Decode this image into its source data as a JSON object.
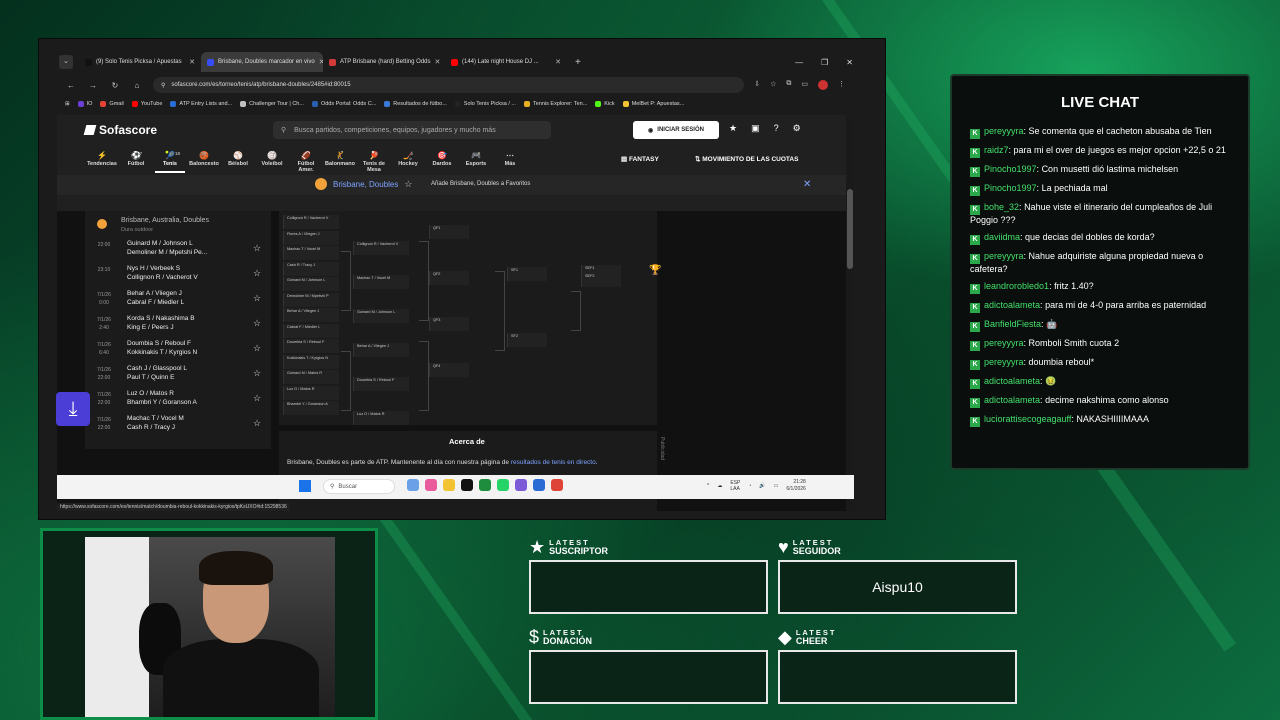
{
  "browser": {
    "tabs": [
      {
        "label": "(9) Solo Tenis Picksa / Apuestas",
        "active": false,
        "color": "#111111"
      },
      {
        "label": "Brisbane, Doubles marcador en vivo",
        "active": true,
        "color": "#374df5"
      },
      {
        "label": "ATP Brisbane (hard) Betting Odds",
        "active": false,
        "color": "#d33a3a"
      },
      {
        "label": "(144) Late night House DJ ...",
        "active": false,
        "color": "#ff0000"
      }
    ],
    "url": "sofascore.com/es/torneo/tenis/atp/brisbane-doubles/2485#id:80015",
    "bookmarks": [
      {
        "label": "IO",
        "color": "#6b3fd6"
      },
      {
        "label": "Gmail",
        "color": "#e34133"
      },
      {
        "label": "YouTube",
        "color": "#ff0000"
      },
      {
        "label": "ATP Entry Lists and...",
        "color": "#2b6cd4"
      },
      {
        "label": "Challenger Tour | Ch...",
        "color": "#c0c0c0"
      },
      {
        "label": "Odds Portal: Odds C...",
        "color": "#2a5fb0"
      },
      {
        "label": "Resultados de fútbo...",
        "color": "#3a7bd5"
      },
      {
        "label": "Solo Tenis Picksa / ...",
        "color": "#222222"
      },
      {
        "label": "Tennis Explorer: Ten...",
        "color": "#e8b020"
      },
      {
        "label": "Kick",
        "color": "#53fc18"
      },
      {
        "label": "MelBet P: Apuestas...",
        "color": "#f2c230"
      }
    ]
  },
  "sofascore": {
    "logo": "Sofascore",
    "search_placeholder": "Busca partidos, competiciones, equipos, jugadores y mucho más",
    "login_label": "INICIAR SESIÓN",
    "sports": [
      {
        "label": "Tendencias",
        "icon": "⚡",
        "count": ""
      },
      {
        "label": "Fútbol",
        "icon": "⚽",
        "count": "7"
      },
      {
        "label": "Tenis",
        "icon": "🎾",
        "count": "18"
      },
      {
        "label": "Baloncesto",
        "icon": "🏀",
        "count": "20"
      },
      {
        "label": "Béisbol",
        "icon": "⚾",
        "count": ""
      },
      {
        "label": "Voleibol",
        "icon": "🏐",
        "count": "4"
      },
      {
        "label": "Fútbol Amer.",
        "icon": "🏈",
        "count": ""
      },
      {
        "label": "Balonmano",
        "icon": "🤾",
        "count": ""
      },
      {
        "label": "Tenis de Mesa",
        "icon": "🏓",
        "count": "6"
      },
      {
        "label": "Hockey",
        "icon": "🏒",
        "count": "4"
      },
      {
        "label": "Dardos",
        "icon": "🎯",
        "count": ""
      },
      {
        "label": "Esports",
        "icon": "🎮",
        "count": "2"
      },
      {
        "label": "Más",
        "icon": "⋯",
        "count": ""
      }
    ],
    "fantasy": "FANTASY",
    "odds_movement": "MOVIMIENTO DE LAS CUOTAS",
    "banner": {
      "title": "Brisbane, Doubles",
      "add_favorite": "Añade Brisbane, Doubles a Favoritos"
    },
    "left_panel": {
      "title": "Brisbane, Australia, Doubles",
      "subtitle": "Dura outdoor",
      "matches": [
        {
          "date": "",
          "time": "22:00",
          "team1": "Guinard M / Johnson L",
          "team2": "Demoliner M / Mpetshi Pe..."
        },
        {
          "date": "",
          "time": "23:10",
          "team1": "Nys H / Verbeek S",
          "team2": "Collignon R / Vacherot V"
        },
        {
          "date": "7/1/26",
          "time": "0:00",
          "team1": "Behar A / Vliegen J",
          "team2": "Cabral F / Miedler L"
        },
        {
          "date": "7/1/26",
          "time": "2:40",
          "team1": "Korda S / Nakashima B",
          "team2": "King E / Peers J"
        },
        {
          "date": "7/1/26",
          "time": "6:40",
          "team1": "Doumbia S / Reboul F",
          "team2": "Kokkinakis T / Kyrgios N"
        },
        {
          "date": "7/1/26",
          "time": "22:00",
          "team1": "Cash J / Glasspool L",
          "team2": "Paul T / Quinn E"
        },
        {
          "date": "7/1/26",
          "time": "22:00",
          "team1": "Luz O / Matos R",
          "team2": "Bhambri Y / Goranson A"
        },
        {
          "date": "7/1/26",
          "time": "22:00",
          "team1": "Machac T / Vocel M",
          "team2": "Cash R / Tracy J"
        }
      ]
    },
    "bracket": {
      "r1": [
        "Collignon R / Vacherot V",
        "Flores A / Vliegen J",
        "Machac T / Vocel M",
        "Cash R / Tracy J",
        "Guinard M / Johnson L",
        "Demoliner M / Mpetshi P",
        "Behar A / Vliegen J",
        "Cabral F / Miedler L",
        "Doumbia S / Reboul F",
        "Kokkinakis T / Kyrgios N",
        "Guinard M / Matos R",
        "Luz O / Matos R",
        "Bhambri Y / Goranson A"
      ],
      "r2": [
        "Collignon R / Vacherot V",
        "Machac T / Vocel M",
        "Guinard M / Johnson L",
        "Behar A / Vliegen J",
        "Doumbia S / Reboul F",
        "Luz O / Matos R"
      ],
      "qf": [
        "QF1",
        "QF2",
        "QF3",
        "QF4"
      ],
      "sf": [
        "SF1",
        "SF2"
      ],
      "f": [
        "SEF1",
        "SEF2"
      ]
    },
    "about": {
      "title": "Acerca de",
      "text_before": "Brisbane, Doubles es parte de ATP. Mantenente al día con nuestra página de ",
      "link": "resultados de tenis en directo",
      "text_after": "."
    },
    "publicidad": "Publicidad",
    "status_url": "https://www.sofascore.com/es/tennis/match/doumbia-reboul-kokkinakis-kyrgios/tpKsUXO#id:15298536"
  },
  "taskbar": {
    "search": "Buscar",
    "lang": "ESP\nLAA",
    "time": "21:28",
    "date": "6/1/2026"
  },
  "chat": {
    "title": "LIVE CHAT",
    "messages": [
      {
        "user": "pereyyyra",
        "text": "Se comenta que el cacheton abusaba de Tien"
      },
      {
        "user": "raidz7",
        "text": "para mi el over de juegos es mejor opcion +22,5 o 21"
      },
      {
        "user": "Pinocho1997",
        "text": "Con musetti dió lastima michelsen"
      },
      {
        "user": "Pinocho1997",
        "text": "La pechiada mal"
      },
      {
        "user": "bohe_32",
        "text": "Nahue viste el itinerario del cumpleaños de Juli Poggio ???"
      },
      {
        "user": "daviidma",
        "text": "que decias del dobles de korda?"
      },
      {
        "user": "pereyyyra",
        "text": "Nahue adquiriste alguna propiedad nueva o cafetera?"
      },
      {
        "user": "leandrorobledo1",
        "text": "fritz 1.40?"
      },
      {
        "user": "adictoalameta",
        "text": "para mi de 4-0 para arriba es paternidad"
      },
      {
        "user": "BanfieldFiesta",
        "text": "🤖"
      },
      {
        "user": "pereyyyra",
        "text": "Romboli Smith cuota 2"
      },
      {
        "user": "pereyyyra",
        "text": "doumbia reboul*"
      },
      {
        "user": "adictoalameta",
        "text": "🤢"
      },
      {
        "user": "adictoalameta",
        "text": "decime nakshima como alonso"
      },
      {
        "user": "luciorattisecogeagauff",
        "text": "NAKASHIIIIMAAA"
      }
    ]
  },
  "latest": {
    "suscriptor": {
      "small": "LATEST",
      "big": "SUSCRIPTOR",
      "icon": "★",
      "value": ""
    },
    "seguidor": {
      "small": "LATEST",
      "big": "SEGUIDOR",
      "icon": "♥",
      "value": "Aispu10"
    },
    "donacion": {
      "small": "LATEST",
      "big": "DONACIÓN",
      "icon": "$",
      "value": ""
    },
    "cheer": {
      "small": "LATEST",
      "big": "CHEER",
      "icon": "◆",
      "value": ""
    }
  }
}
